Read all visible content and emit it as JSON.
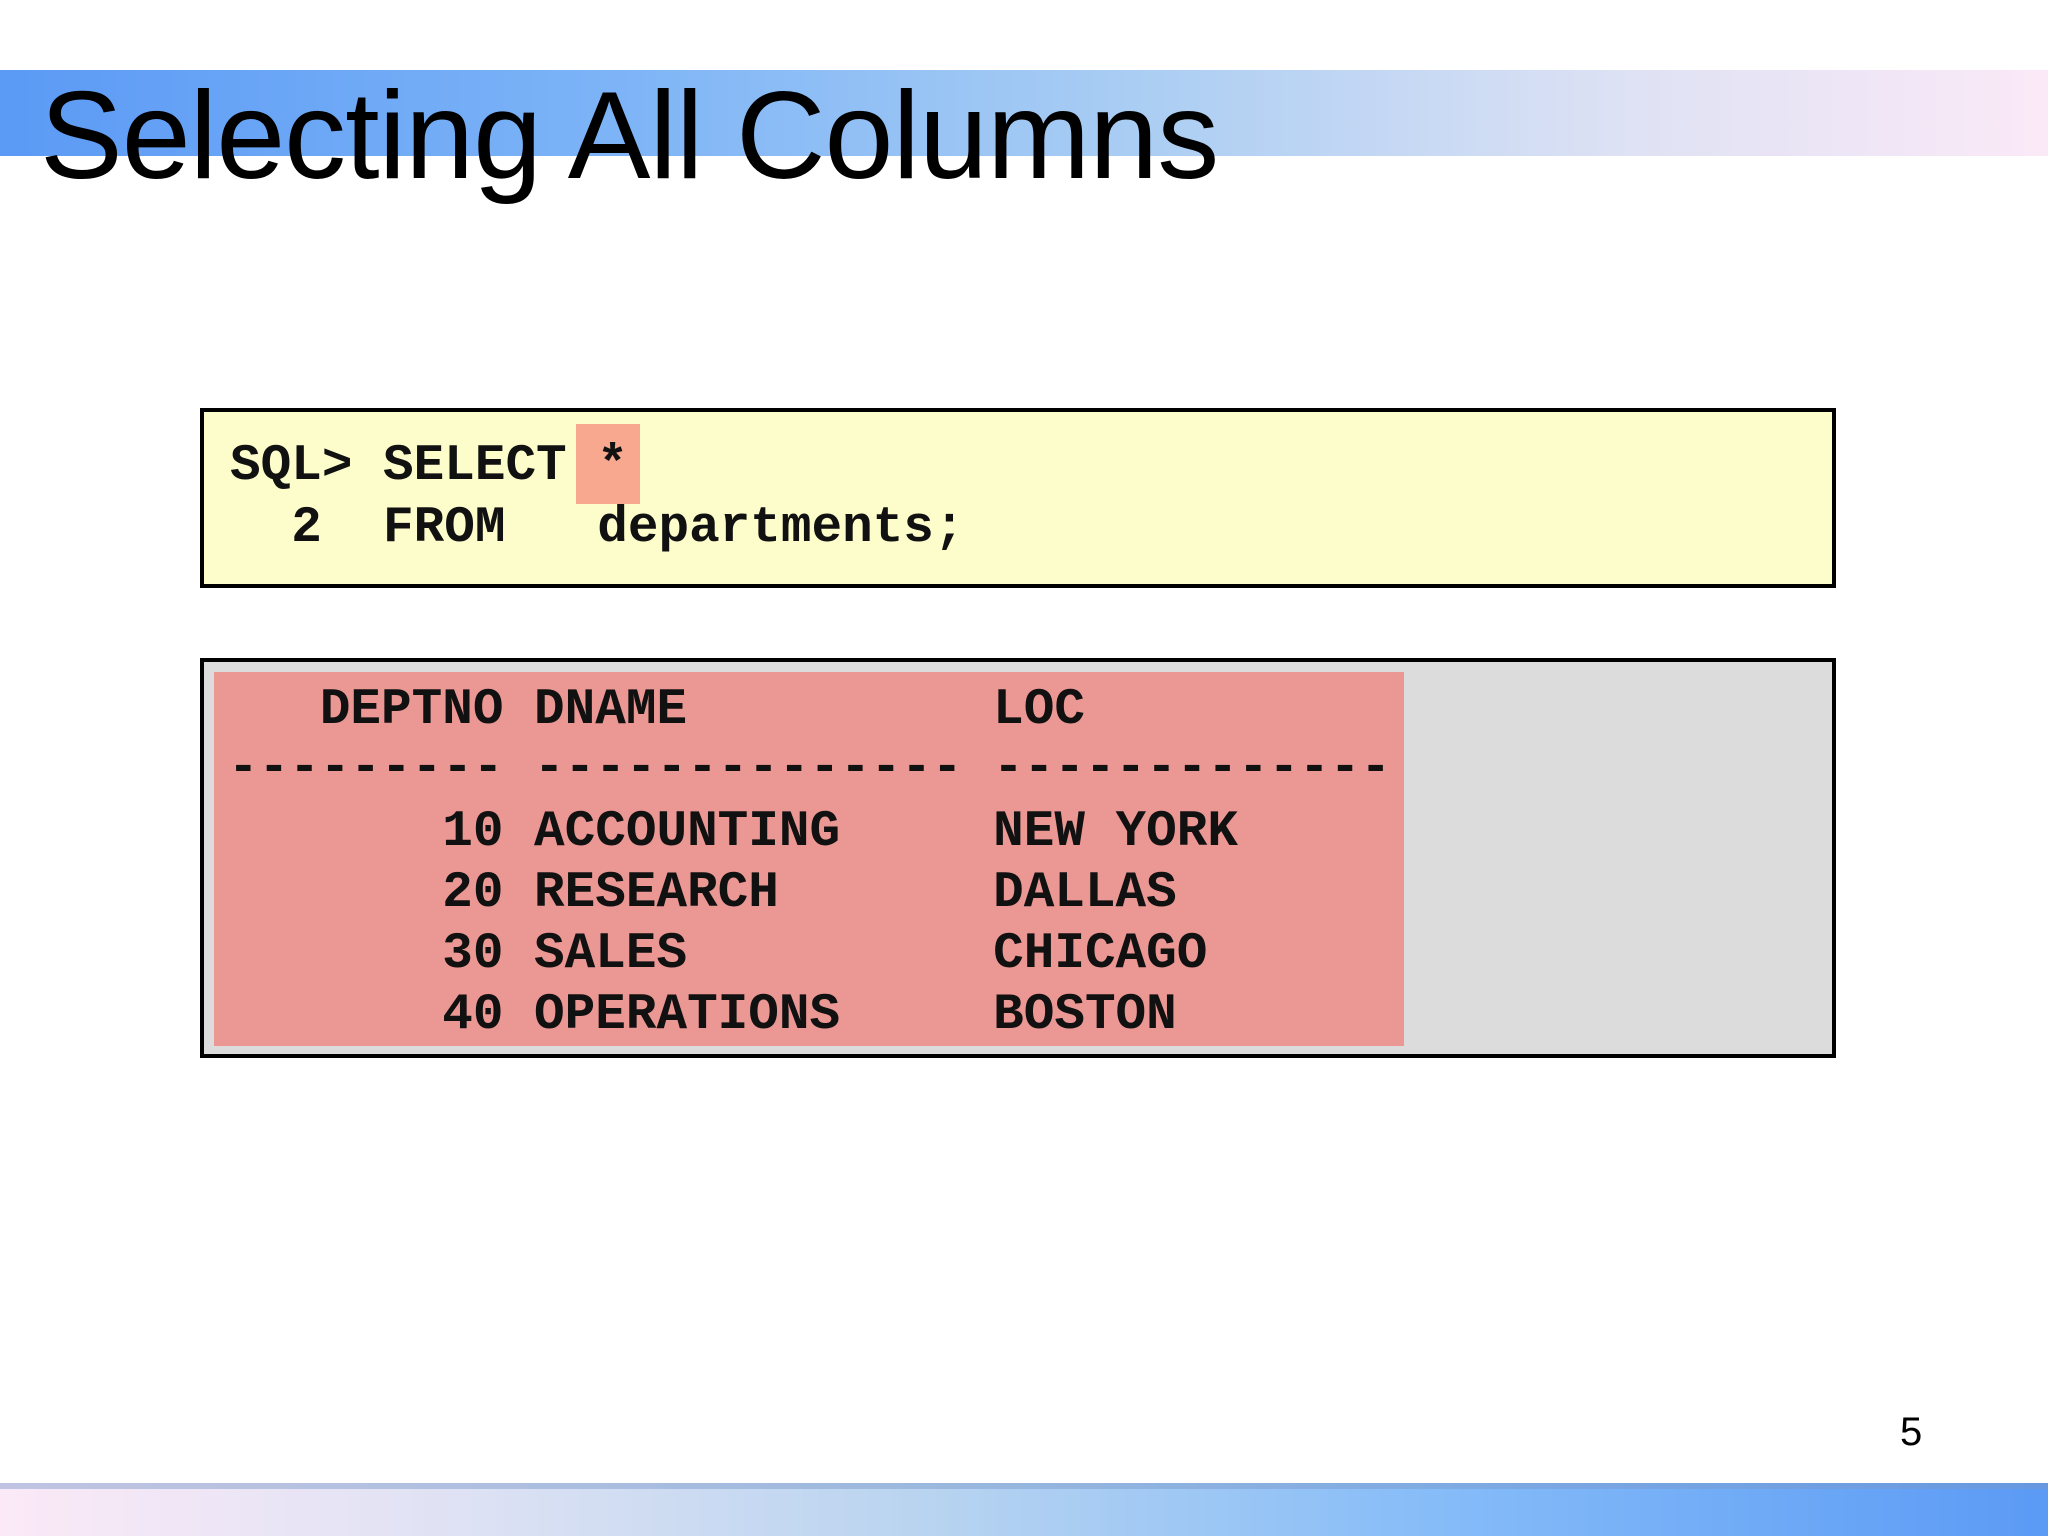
{
  "slide": {
    "title": "Selecting All Columns",
    "page_number": "5"
  },
  "query": {
    "line1_prefix": "SQL> SELECT ",
    "line1_star": "*",
    "line2": "  2  FROM   departments;"
  },
  "result": {
    "header": "   DEPTNO DNAME          LOC",
    "separator": "--------- -------------- -------------",
    "rows": [
      "       10 ACCOUNTING     NEW YORK",
      "       20 RESEARCH       DALLAS",
      "       30 SALES          CHICAGO",
      "       40 OPERATIONS     BOSTON"
    ]
  },
  "colors": {
    "query_background": "#fdfccb",
    "highlight_star": "#f8a88f",
    "result_highlight": "#eb9794",
    "result_background": "#dcdcdc"
  }
}
